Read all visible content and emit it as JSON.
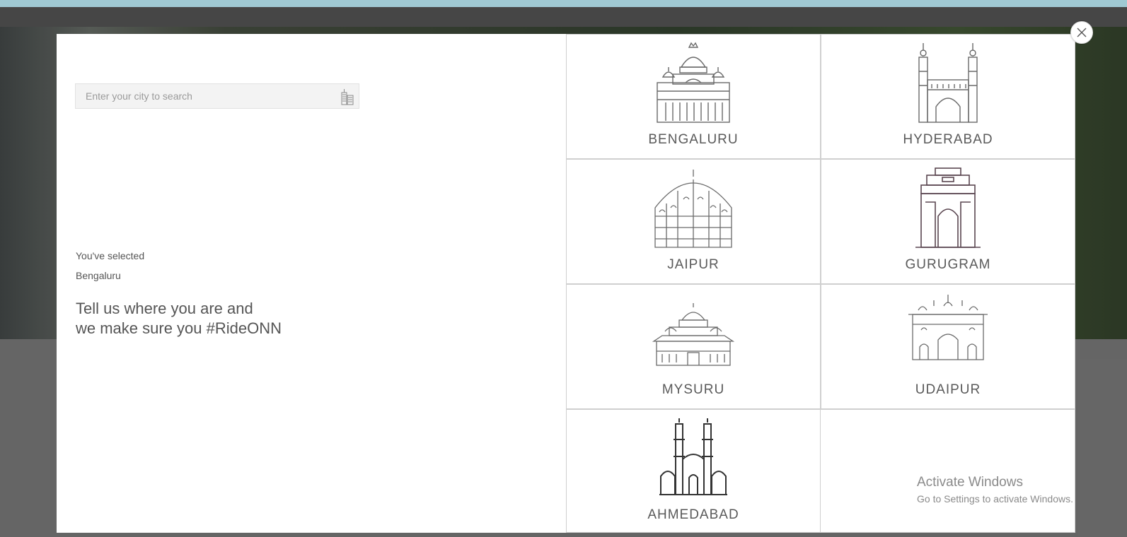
{
  "search": {
    "placeholder": "Enter your city to search"
  },
  "selection": {
    "label": "You've selected",
    "city": "Bengaluru"
  },
  "tagline": {
    "line1": "Tell us where you are and",
    "line2": "we make sure you #RideONN"
  },
  "cities": [
    {
      "name": "BENGALURU",
      "icon": "bengaluru-palace-icon"
    },
    {
      "name": "HYDERABAD",
      "icon": "charminar-icon"
    },
    {
      "name": "JAIPUR",
      "icon": "hawa-mahal-icon"
    },
    {
      "name": "GURUGRAM",
      "icon": "india-gate-icon"
    },
    {
      "name": "MYSURU",
      "icon": "mysore-palace-icon"
    },
    {
      "name": "UDAIPUR",
      "icon": "udaipur-palace-icon"
    },
    {
      "name": "AHMEDABAD",
      "icon": "ahmedabad-mosque-icon"
    }
  ],
  "watermark": {
    "title": "Activate Windows",
    "subtitle": "Go to Settings to activate Windows."
  },
  "colors": {
    "modal_bg": "#ffffff",
    "text": "#555555",
    "cell_border": "#cfcfcf",
    "top_strip": "#a9d4df"
  }
}
